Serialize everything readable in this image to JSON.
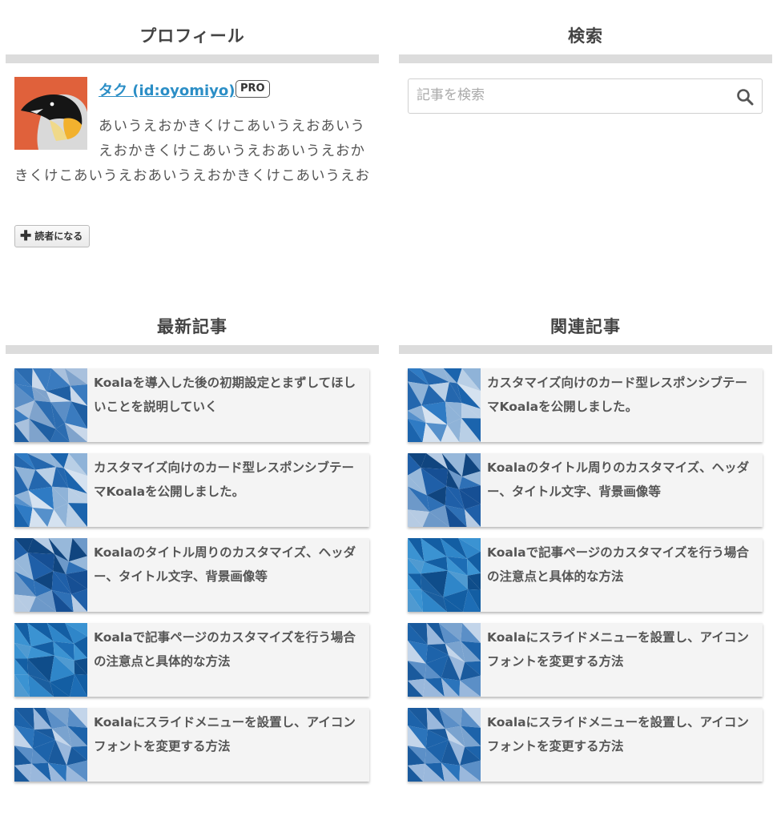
{
  "profile": {
    "title": "プロフィール",
    "name": "タク (id:oyomiyo)",
    "badge": "PRO",
    "description": "あいうえおかきくけこあいうえおあいうえおかきくけこあいうえおあいうえおかきくけこあいうえおあいうえおかきくけこあいうえお",
    "follow_label": "読者になる"
  },
  "search": {
    "title": "検索",
    "placeholder": "記事を検索"
  },
  "latest": {
    "title": "最新記事",
    "articles": [
      "Koalaを導入した後の初期設定とまずしてほしいことを説明していく",
      "カスタマイズ向けのカード型レスポンシブテーマKoalaを公開しました。",
      "Koalaのタイトル周りのカスタマイズ、ヘッダー、タイトル文字、背景画像等",
      "Koalaで記事ページのカスタマイズを行う場合の注意点と具体的な方法",
      "Koalaにスライドメニューを設置し、アイコンフォントを変更する方法"
    ]
  },
  "related": {
    "title": "関連記事",
    "articles": [
      "カスタマイズ向けのカード型レスポンシブテーマKoalaを公開しました。",
      "Koalaのタイトル周りのカスタマイズ、ヘッダー、タイトル文字、背景画像等",
      "Koalaで記事ページのカスタマイズを行う場合の注意点と具体的な方法",
      "Koalaにスライドメニューを設置し、アイコンフォントを変更する方法",
      "Koalaにスライドメニューを設置し、アイコンフォントを変更する方法"
    ]
  },
  "colors": {
    "link": "#2b8ec6",
    "title_bar": "#dcdcdc",
    "card_bg": "#f4f4f4",
    "avatar_bg": "#e0613b"
  },
  "icons": {
    "avatar": "penguin-icon",
    "follow": "plus-icon",
    "search": "search-icon",
    "thumbnail": "blue-polygon-thumbnail"
  }
}
